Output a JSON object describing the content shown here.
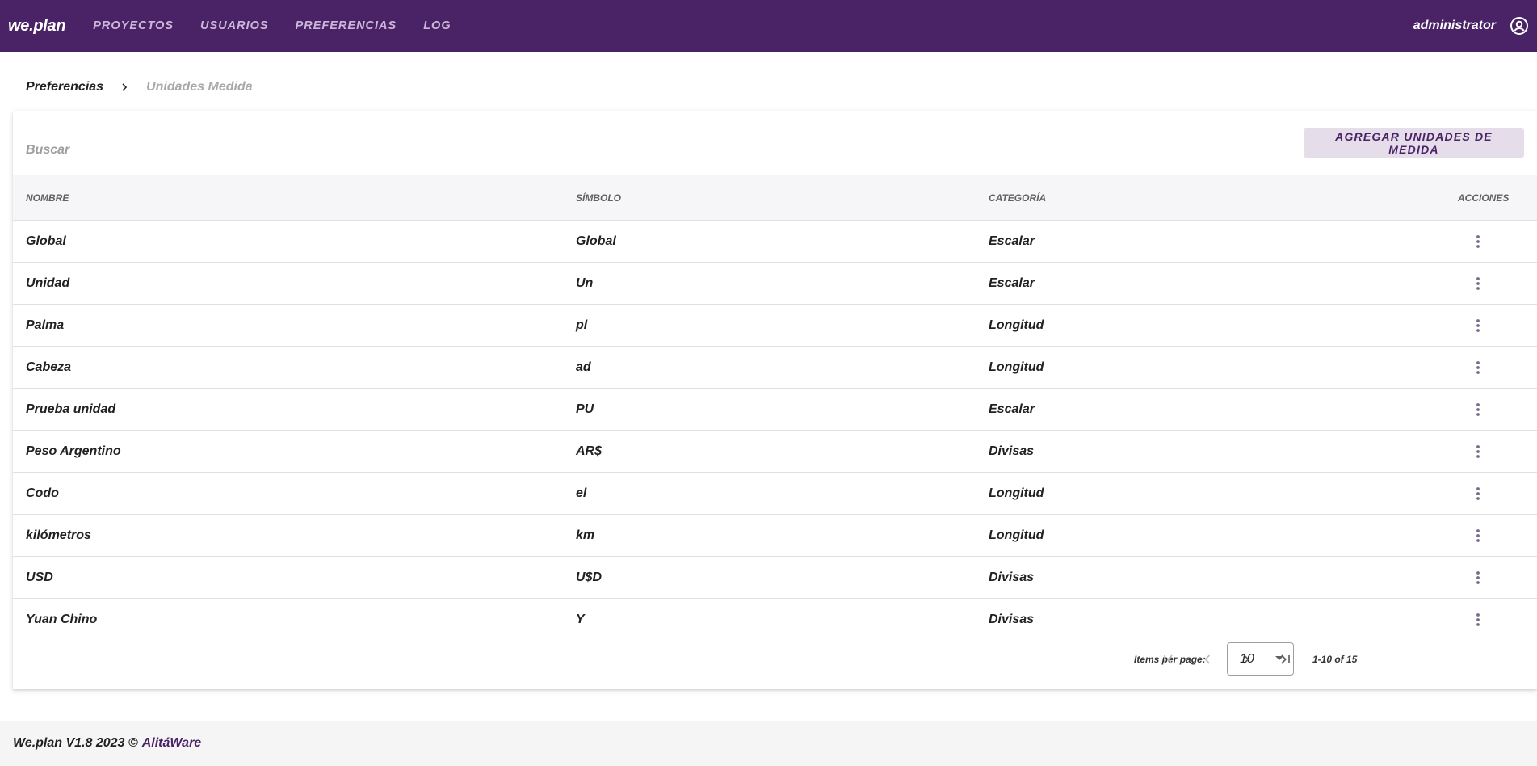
{
  "app": {
    "brand": "we.plan",
    "nav": [
      "PROYECTOS",
      "USUARIOS",
      "PREFERENCIAS",
      "LOG"
    ],
    "user": "administrator"
  },
  "breadcrumb": {
    "parent": "Preferencias",
    "current": "Unidades Medida"
  },
  "search": {
    "placeholder": "Buscar",
    "value": ""
  },
  "actions": {
    "add_label": "AGREGAR UNIDADES DE MEDIDA"
  },
  "table": {
    "headers": {
      "name": "NOMBRE",
      "symbol": "SÍMBOLO",
      "category": "CATEGORÍA",
      "actions": "ACCIONES"
    },
    "rows": [
      {
        "name": "Global",
        "symbol": "Global",
        "category": "Escalar"
      },
      {
        "name": "Unidad",
        "symbol": "Un",
        "category": "Escalar"
      },
      {
        "name": "Palma",
        "symbol": "pl",
        "category": "Longitud"
      },
      {
        "name": "Cabeza",
        "symbol": "ad",
        "category": "Longitud"
      },
      {
        "name": "Prueba unidad",
        "symbol": "PU",
        "category": "Escalar"
      },
      {
        "name": "Peso Argentino",
        "symbol": "AR$",
        "category": "Divisas"
      },
      {
        "name": "Codo",
        "symbol": "el",
        "category": "Longitud"
      },
      {
        "name": "kilómetros",
        "symbol": "km",
        "category": "Longitud"
      },
      {
        "name": "USD",
        "symbol": "U$D",
        "category": "Divisas"
      },
      {
        "name": "Yuan Chino",
        "symbol": "Y",
        "category": "Divisas"
      }
    ]
  },
  "paginator": {
    "items_per_page_label": "Items per page:",
    "items_per_page": "10",
    "range": "1-10 of 15"
  },
  "footer": {
    "text": "We.plan V1.8 2023 ©",
    "link": "AlitáWare"
  },
  "colors": {
    "primary": "#4a2266",
    "nav_inactive": "#cbb8d8",
    "button_bg": "#e5dde9",
    "kebab": "#7a6a8a"
  },
  "icons": {
    "user": "account-circle-icon",
    "breadcrumb_sep": "chevron-right-icon",
    "row_menu": "more-vert-icon",
    "select_arrow": "arrow-drop-down-icon",
    "first": "first-page-icon",
    "prev": "chevron-left-icon",
    "next": "chevron-right-icon",
    "last": "last-page-icon"
  }
}
